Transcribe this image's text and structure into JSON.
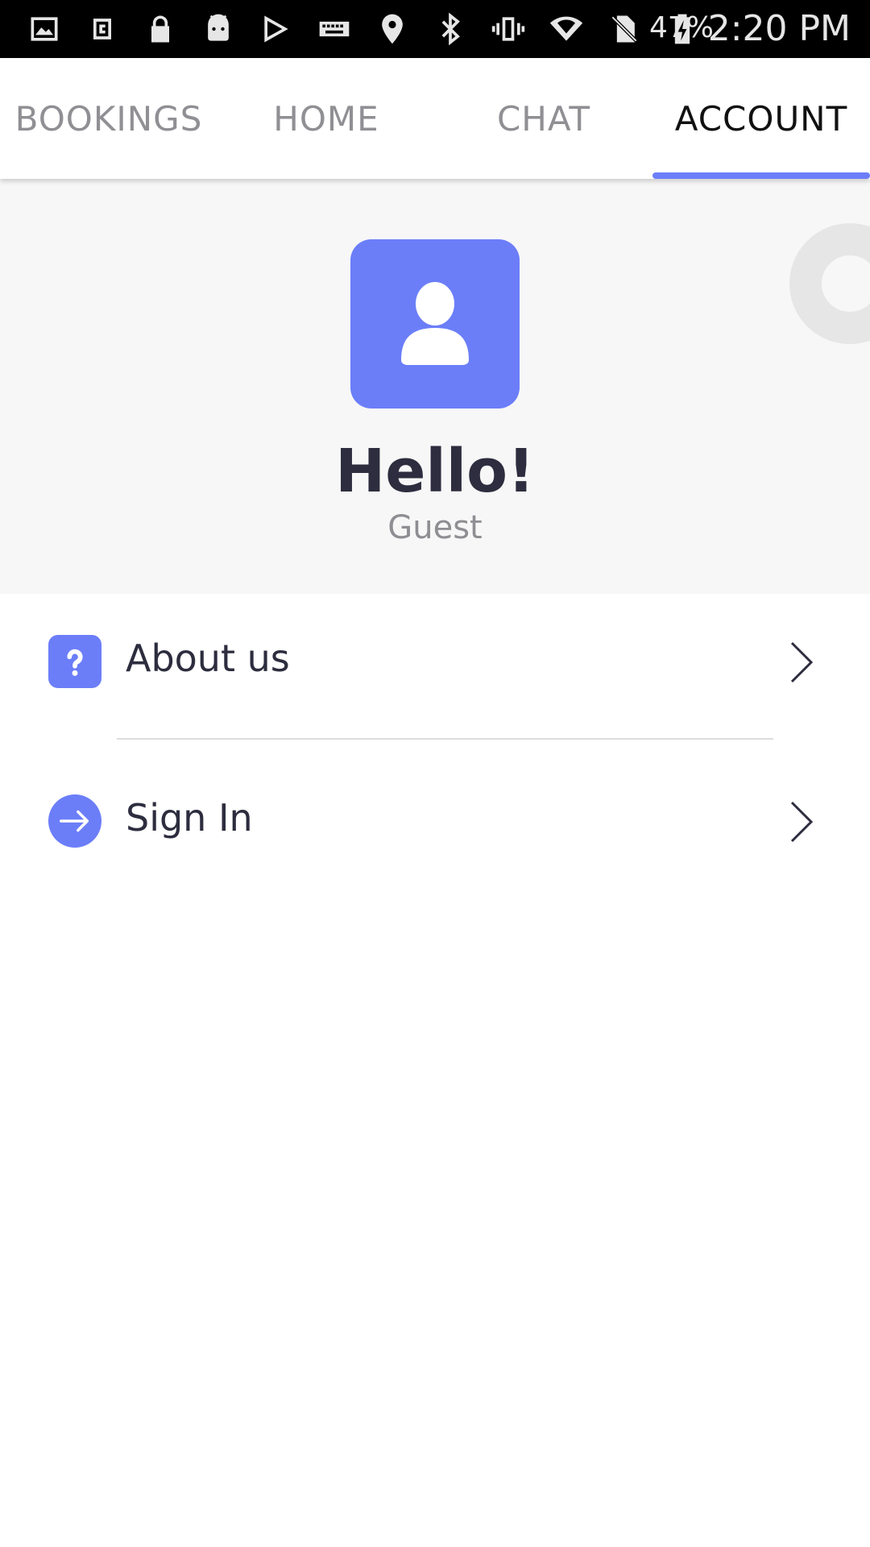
{
  "status_bar": {
    "battery_percent": "47%",
    "time": "2:20 PM",
    "icons": [
      "gallery-icon",
      "screen-icon",
      "lock-icon",
      "android-icon",
      "play-store-icon",
      "keyboard-icon",
      "location-icon",
      "bluetooth-icon",
      "vibrate-icon",
      "wifi-icon",
      "no-sim-icon",
      "battery-charging-icon"
    ]
  },
  "tabs": [
    {
      "label": "BOOKINGS",
      "active": false
    },
    {
      "label": "HOME",
      "active": false
    },
    {
      "label": "CHAT",
      "active": false
    },
    {
      "label": "ACCOUNT",
      "active": true
    }
  ],
  "profile": {
    "greeting": "Hello!",
    "name": "Guest",
    "avatar_icon": "user-icon"
  },
  "menu": [
    {
      "label": "About us",
      "icon": "question-icon"
    },
    {
      "label": "Sign In",
      "icon": "arrow-right-icon"
    }
  ],
  "colors": {
    "accent": "#6b7ef8",
    "text_dark": "#2d2d3f",
    "text_muted": "#8e8e93",
    "hero_bg": "#f7f7f7",
    "status_bar_bg": "#000000"
  }
}
